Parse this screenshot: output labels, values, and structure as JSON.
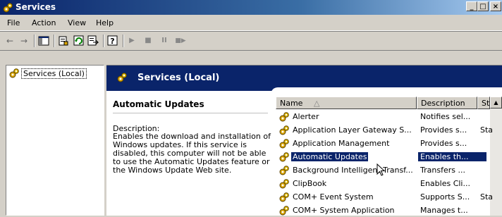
{
  "window": {
    "title": "Services",
    "controls": [
      "_",
      "□",
      "×"
    ]
  },
  "menu": [
    "File",
    "Action",
    "View",
    "Help"
  ],
  "toolbar": [
    "back",
    "forward",
    "show-hide-tree",
    "properties",
    "refresh",
    "export-list",
    "help",
    "start",
    "stop",
    "pause",
    "restart"
  ],
  "tree": {
    "root": "Services (Local)"
  },
  "panel_header": "Services (Local)",
  "description": {
    "service_name": "Automatic Updates",
    "label": "Description:",
    "text": "Enables the download and installation of Windows updates. If this service is disabled, this computer will not be able to use the Automatic Updates feature or the Windows Update Web site."
  },
  "list": {
    "columns": [
      "Name",
      "Description",
      "Sta"
    ],
    "sort_indicator": "△",
    "rows": [
      {
        "name": "Alerter",
        "description": "Notifies sel...",
        "status": ""
      },
      {
        "name": "Application Layer Gateway S...",
        "description": "Provides s...",
        "status": "Sta"
      },
      {
        "name": "Application Management",
        "description": "Provides s...",
        "status": ""
      },
      {
        "name": "Automatic Updates",
        "description": "Enables th...",
        "status": "",
        "selected": true
      },
      {
        "name": "Background Intelligent Transf...",
        "description": "Transfers ...",
        "status": ""
      },
      {
        "name": "ClipBook",
        "description": "Enables Cli...",
        "status": ""
      },
      {
        "name": "COM+ Event System",
        "description": "Supports S...",
        "status": "Sta"
      },
      {
        "name": "COM+ System Application",
        "description": "Manages t...",
        "status": ""
      }
    ]
  },
  "colors": {
    "title_active": "#0a246a",
    "selection": "#0a246a",
    "face": "#d4d0c8"
  }
}
